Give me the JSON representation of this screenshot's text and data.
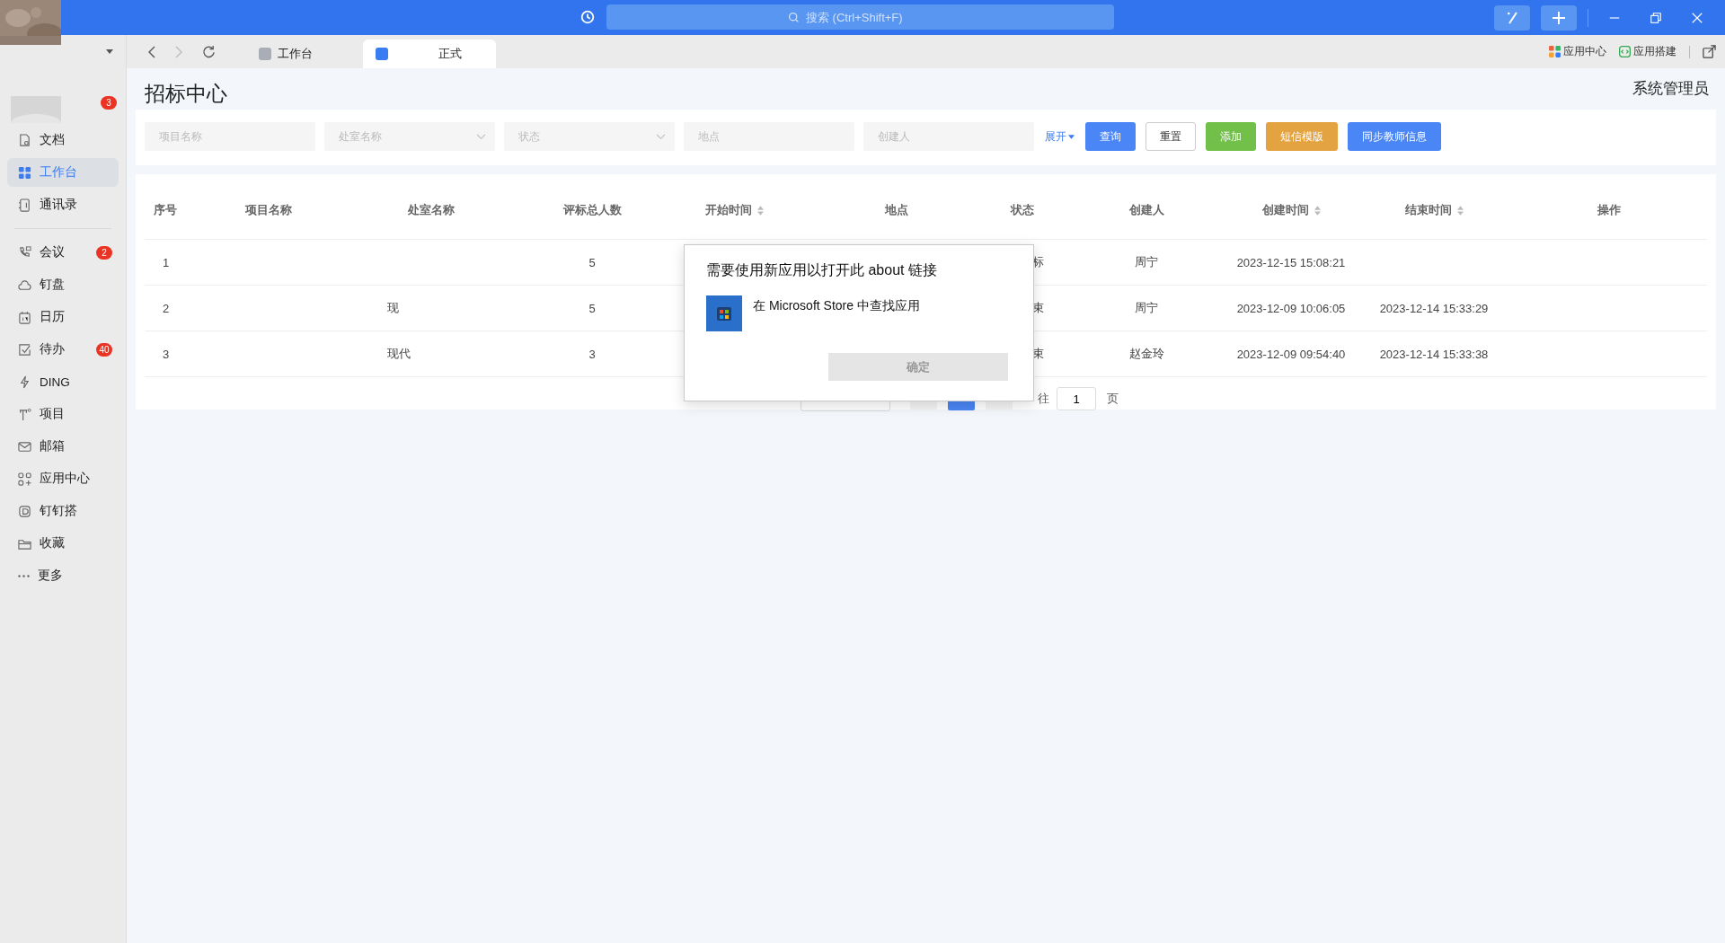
{
  "titlebar": {
    "search": {
      "placeholder": "搜索 (Ctrl+Shift+F)"
    }
  },
  "tabs": [
    {
      "label": "工作台",
      "selected": false
    },
    {
      "label": "正式",
      "selected": true
    }
  ],
  "toolbar_links": [
    "应用中心",
    "应用搭建"
  ],
  "sidebar": {
    "account_badge": "3",
    "items": [
      {
        "label": "文档",
        "selected": false
      },
      {
        "label": "工作台",
        "selected": true
      },
      {
        "label": "通讯录",
        "selected": false
      },
      {
        "label": "会议",
        "selected": false,
        "badge": "2"
      },
      {
        "label": "钉盘",
        "selected": false
      },
      {
        "label": "日历",
        "selected": false
      },
      {
        "label": "待办",
        "selected": false,
        "badge": "40"
      },
      {
        "label": "DING",
        "selected": false
      },
      {
        "label": "项目",
        "selected": false
      },
      {
        "label": "邮箱",
        "selected": false
      },
      {
        "label": "应用中心",
        "selected": false
      },
      {
        "label": "钉钉搭",
        "selected": false
      },
      {
        "label": "收藏",
        "selected": false
      },
      {
        "label": "更多",
        "selected": false
      }
    ]
  },
  "page": {
    "title": "招标中心",
    "user": "系统管理员"
  },
  "filters": [
    {
      "placeholder": "项目名称",
      "kind": "input"
    },
    {
      "placeholder": "处室名称",
      "kind": "select"
    },
    {
      "placeholder": "状态",
      "kind": "select"
    },
    {
      "placeholder": "地点",
      "kind": "input"
    },
    {
      "placeholder": "创建人",
      "kind": "input"
    }
  ],
  "expand_link": "展开",
  "buttons": [
    {
      "label": "查询",
      "kind": "primary"
    },
    {
      "label": "重置",
      "kind": "plain"
    },
    {
      "label": "添加",
      "kind": "success"
    },
    {
      "label": "短信模版",
      "kind": "warning"
    },
    {
      "label": "同步教师信息",
      "kind": "primary"
    }
  ],
  "table": {
    "columns": [
      {
        "label": "序号",
        "sortable": false
      },
      {
        "label": "项目名称",
        "sortable": false
      },
      {
        "label": "处室名称",
        "sortable": false
      },
      {
        "label": "评标总人数",
        "sortable": false
      },
      {
        "label": "开始时间",
        "sortable": true
      },
      {
        "label": "地点",
        "sortable": false
      },
      {
        "label": "状态",
        "sortable": false
      },
      {
        "label": "创建人",
        "sortable": false
      },
      {
        "label": "创建时间",
        "sortable": true
      },
      {
        "label": "结束时间",
        "sortable": true
      },
      {
        "label": "操作",
        "sortable": false
      }
    ],
    "rows": [
      {
        "no": "1",
        "count": "5",
        "status": "标",
        "creator": "周宁",
        "created": "2023-12-15 15:08:21"
      },
      {
        "no": "2",
        "office": "现",
        "count": "5",
        "status": "束",
        "creator": "周宁",
        "created": "2023-12-09 10:06:05",
        "ended": "2023-12-14 15:33:29"
      },
      {
        "no": "3",
        "office": "现代",
        "count": "3",
        "status": "束",
        "creator": "赵金玲",
        "created": "2023-12-09 09:54:40",
        "ended": "2023-12-14 15:33:38"
      }
    ]
  },
  "pagination": {
    "goto_label": "往",
    "page_input": "1",
    "page_suffix": "页"
  },
  "dialog": {
    "title": "需要使用新应用以打开此 about 链接",
    "option": "在 Microsoft Store 中查找应用",
    "ok": "确定"
  }
}
